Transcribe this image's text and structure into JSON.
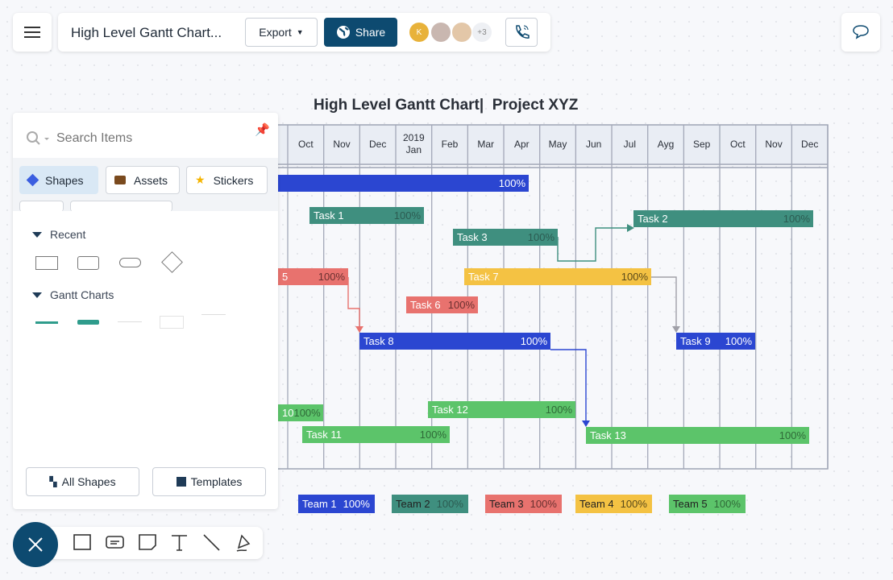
{
  "header": {
    "title": "High Level Gantt Chart...",
    "export_label": "Export",
    "share_label": "Share",
    "avatar_initial": "K",
    "extra_count": "+3"
  },
  "chart_data": {
    "type": "gantt",
    "title": "High Level Gantt Chart|  Project XYZ",
    "months": [
      {
        "label": "Oct"
      },
      {
        "label": "Nov"
      },
      {
        "label": "Dec"
      },
      {
        "label": "2019\nJan"
      },
      {
        "label": "Feb"
      },
      {
        "label": "Mar"
      },
      {
        "label": "Apr"
      },
      {
        "label": "May"
      },
      {
        "label": "Jun"
      },
      {
        "label": "Jul"
      },
      {
        "label": "Ayg"
      },
      {
        "label": "Sep"
      },
      {
        "label": "Oct"
      },
      {
        "label": "Nov"
      },
      {
        "label": "Dec"
      }
    ],
    "tasks": [
      {
        "label": "",
        "percent": "100%",
        "team": "Team 1"
      },
      {
        "label": "Task 1",
        "percent": "100%",
        "team": "Team 2"
      },
      {
        "label": "Task 2",
        "percent": "100%",
        "team": "Team 2"
      },
      {
        "label": "Task 3",
        "percent": "100%",
        "team": "Team 2"
      },
      {
        "label": "5",
        "percent": "100%",
        "team": "Team 3"
      },
      {
        "label": "Task 7",
        "percent": "100%",
        "team": "Team 4"
      },
      {
        "label": "Task 6",
        "percent": "100%",
        "team": "Team 3"
      },
      {
        "label": "Task 8",
        "percent": "100%",
        "team": "Team 1"
      },
      {
        "label": "Task 9",
        "percent": "100%",
        "team": "Team 1"
      },
      {
        "label": "10",
        "percent": "100%",
        "team": "Team 5"
      },
      {
        "label": "Task 12",
        "percent": "100%",
        "team": "Team 5"
      },
      {
        "label": "Task 11",
        "percent": "100%",
        "team": "Team 5"
      },
      {
        "label": "Task 13",
        "percent": "100%",
        "team": "Team 5"
      }
    ],
    "legend": [
      {
        "label": "Team 1",
        "percent": "100%",
        "color": "#2b46d1"
      },
      {
        "label": "Team 2",
        "percent": "100%",
        "color": "#3f8f7f"
      },
      {
        "label": "Team 3",
        "percent": "100%",
        "color": "#e8726e"
      },
      {
        "label": "Team 4",
        "percent": "100%",
        "color": "#f4c243"
      },
      {
        "label": "Team 5",
        "percent": "100%",
        "color": "#5cc46a"
      }
    ]
  },
  "panel": {
    "search_placeholder": "Search Items",
    "tabs": [
      "Shapes",
      "Assets",
      "Stickers"
    ],
    "recent": "Recent",
    "gantt": "Gantt Charts",
    "all_shapes": "All Shapes",
    "templates": "Templates"
  },
  "colors": {
    "primary": "#0d4a70"
  }
}
